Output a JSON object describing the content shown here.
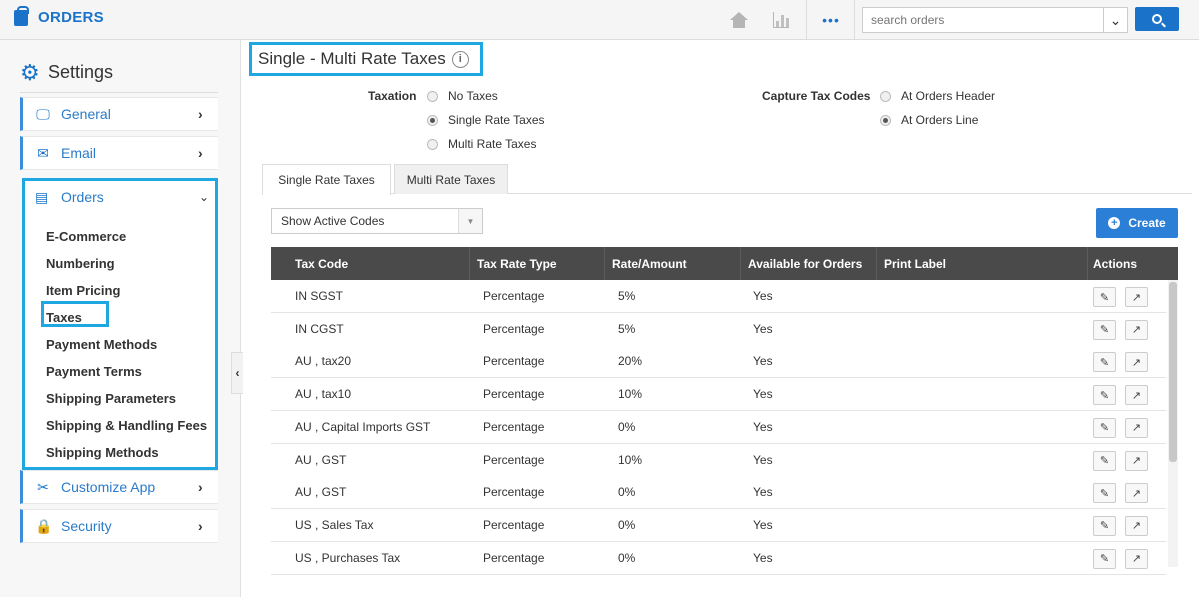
{
  "app": {
    "title": "ORDERS"
  },
  "topbar": {
    "more_label": "•••",
    "search_placeholder": "search orders",
    "search_dropdown": "⌄"
  },
  "sidebar": {
    "heading": "Settings",
    "items": [
      {
        "label": "General",
        "icon": "monitor-icon"
      },
      {
        "label": "Email",
        "icon": "envelope-icon"
      },
      {
        "label": "Orders",
        "icon": "orders-icon"
      },
      {
        "label": "Customize App",
        "icon": "tools-icon"
      },
      {
        "label": "Security",
        "icon": "lock-icon"
      }
    ],
    "orders_sub": [
      "E-Commerce",
      "Numbering",
      "Item Pricing",
      "Taxes",
      "Payment Methods",
      "Payment Terms",
      "Shipping Parameters",
      "Shipping & Handling Fees",
      "Shipping Methods"
    ]
  },
  "page": {
    "title": "Single - Multi Rate Taxes",
    "taxation_label": "Taxation",
    "taxation_options": [
      "No Taxes",
      "Single Rate Taxes",
      "Multi Rate Taxes"
    ],
    "taxation_selected": "Single Rate Taxes",
    "capture_label": "Capture Tax Codes",
    "capture_options": [
      "At Orders Header",
      "At Orders Line"
    ],
    "capture_selected": "At Orders Line",
    "tabs": [
      "Single Rate Taxes",
      "Multi Rate Taxes"
    ],
    "active_tab": "Single Rate Taxes",
    "filter_value": "Show Active Codes",
    "create_label": "Create"
  },
  "table": {
    "columns": [
      "Tax Code",
      "Tax Rate Type",
      "Rate/Amount",
      "Available for Orders",
      "Print Label",
      "Actions"
    ],
    "rows": [
      {
        "code": "IN SGST",
        "type": "Percentage",
        "rate": "5%",
        "available": "Yes",
        "label": ""
      },
      {
        "code": "IN CGST",
        "type": "Percentage",
        "rate": "5%",
        "available": "Yes",
        "label": ""
      },
      {
        "code": "AU , tax20",
        "type": "Percentage",
        "rate": "20%",
        "available": "Yes",
        "label": ""
      },
      {
        "code": "AU , tax10",
        "type": "Percentage",
        "rate": "10%",
        "available": "Yes",
        "label": ""
      },
      {
        "code": "AU , Capital Imports GST",
        "type": "Percentage",
        "rate": "0%",
        "available": "Yes",
        "label": ""
      },
      {
        "code": "AU , GST",
        "type": "Percentage",
        "rate": "10%",
        "available": "Yes",
        "label": ""
      },
      {
        "code": "AU , GST",
        "type": "Percentage",
        "rate": "0%",
        "available": "Yes",
        "label": ""
      },
      {
        "code": "US , Sales Tax",
        "type": "Percentage",
        "rate": "0%",
        "available": "Yes",
        "label": ""
      },
      {
        "code": "US , Purchases Tax",
        "type": "Percentage",
        "rate": "0%",
        "available": "Yes",
        "label": ""
      }
    ]
  },
  "colors": {
    "accent": "#1a73c9",
    "highlight": "#1ea7e1",
    "table_header": "#4a4a4a"
  }
}
